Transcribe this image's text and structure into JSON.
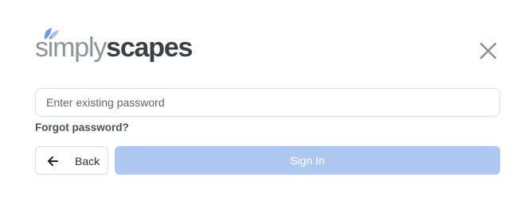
{
  "logo": {
    "part1": "simply",
    "part2": "scapes",
    "icon": "leaf-icon",
    "leaf_colors": [
      "#6f96ea",
      "#a9c1f1"
    ]
  },
  "close_icon": "close-icon",
  "password": {
    "placeholder": "Enter existing password",
    "value": ""
  },
  "forgot_label": "Forgot password?",
  "back": {
    "label": "Back",
    "icon": "arrow-left-icon"
  },
  "sign_in": {
    "label": "Sign In",
    "state": "disabled"
  },
  "colors": {
    "primary_disabled": "#aec8f2",
    "text_dark": "#2b3036",
    "border": "#d9dce1"
  }
}
